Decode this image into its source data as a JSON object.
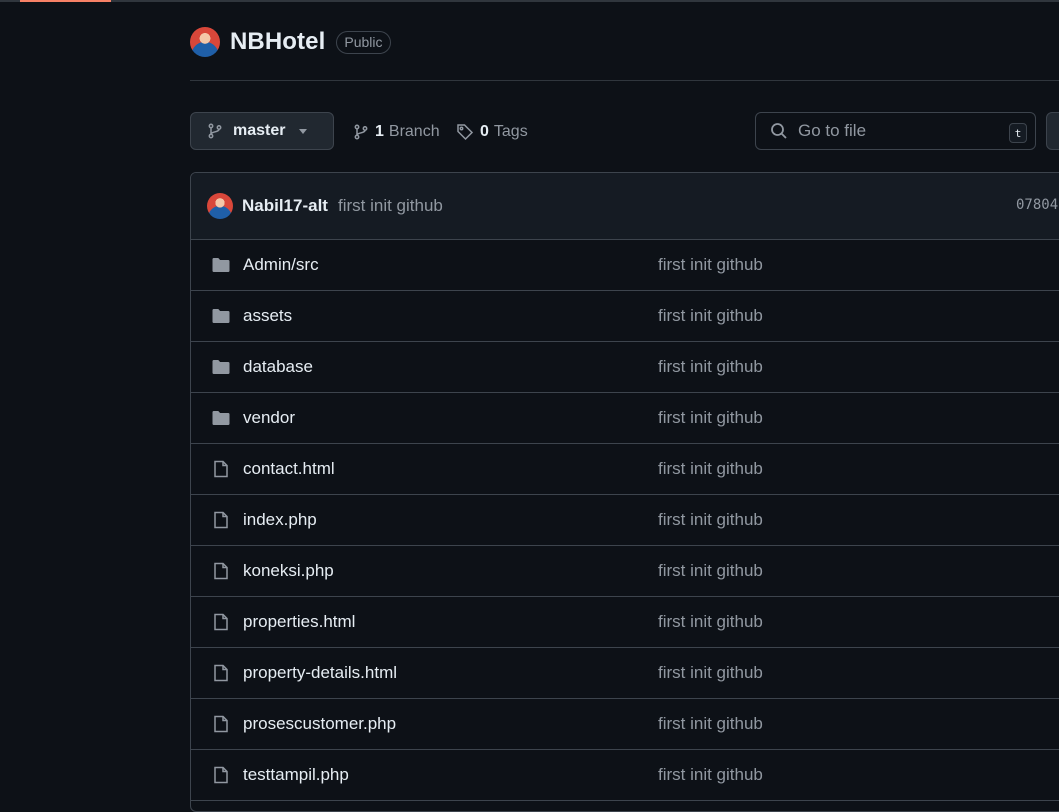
{
  "repo": {
    "name": "NBHotel",
    "visibility": "Public"
  },
  "toolbar": {
    "branch_name": "master",
    "branch_count": "1",
    "branch_label": "Branch",
    "tag_count": "0",
    "tag_label": "Tags",
    "search_placeholder": "Go to file",
    "search_shortcut": "t"
  },
  "latest_commit": {
    "author": "Nabil17-alt",
    "message": "first init github",
    "hash": "07804"
  },
  "files": [
    {
      "name": "Admin/src",
      "type": "folder",
      "message": "first init github"
    },
    {
      "name": "assets",
      "type": "folder",
      "message": "first init github"
    },
    {
      "name": "database",
      "type": "folder",
      "message": "first init github"
    },
    {
      "name": "vendor",
      "type": "folder",
      "message": "first init github"
    },
    {
      "name": "contact.html",
      "type": "file",
      "message": "first init github"
    },
    {
      "name": "index.php",
      "type": "file",
      "message": "first init github"
    },
    {
      "name": "koneksi.php",
      "type": "file",
      "message": "first init github"
    },
    {
      "name": "properties.html",
      "type": "file",
      "message": "first init github"
    },
    {
      "name": "property-details.html",
      "type": "file",
      "message": "first init github"
    },
    {
      "name": "prosescustomer.php",
      "type": "file",
      "message": "first init github"
    },
    {
      "name": "testtampil.php",
      "type": "file",
      "message": "first init github"
    }
  ],
  "colors": {
    "background": "#0d1117",
    "border": "#3d444d",
    "text_primary": "#e6edf3",
    "text_muted": "#9198a1",
    "active_tab_underline": "#f78166",
    "folder_icon": "#9198a1"
  }
}
